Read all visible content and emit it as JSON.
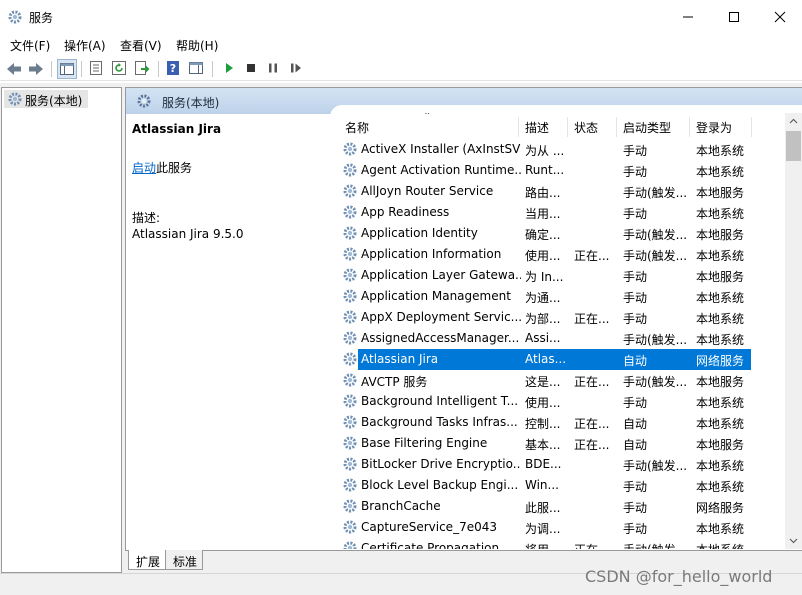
{
  "window": {
    "title": "服务"
  },
  "menu": [
    "文件(F)",
    "操作(A)",
    "查看(V)",
    "帮助(H)"
  ],
  "tree": {
    "selected_label": "服务(本地)"
  },
  "panel": {
    "header_label": "服务(本地)"
  },
  "description": {
    "service_title": "Atlassian Jira",
    "start_link": "启动",
    "start_suffix": "此服务",
    "desc_label": "描述:",
    "desc_text": "Atlassian Jira 9.5.0"
  },
  "columns": {
    "name": "名称",
    "description": "描述",
    "status": "状态",
    "startup_type": "启动类型",
    "logon_as": "登录为"
  },
  "services": [
    {
      "name": "ActiveX Installer (AxInstSV)",
      "description": "为从 ...",
      "status": "",
      "startup": "手动",
      "logon": "本地系统"
    },
    {
      "name": "Agent Activation Runtime...",
      "description": "Runt...",
      "status": "",
      "startup": "手动",
      "logon": "本地系统"
    },
    {
      "name": "AllJoyn Router Service",
      "description": "路由...",
      "status": "",
      "startup": "手动(触发...",
      "logon": "本地服务"
    },
    {
      "name": "App Readiness",
      "description": "当用...",
      "status": "",
      "startup": "手动",
      "logon": "本地系统"
    },
    {
      "name": "Application Identity",
      "description": "确定...",
      "status": "",
      "startup": "手动(触发...",
      "logon": "本地服务"
    },
    {
      "name": "Application Information",
      "description": "使用...",
      "status": "正在...",
      "startup": "手动(触发...",
      "logon": "本地系统"
    },
    {
      "name": "Application Layer Gatewa...",
      "description": "为 In...",
      "status": "",
      "startup": "手动",
      "logon": "本地服务"
    },
    {
      "name": "Application Management",
      "description": "为通...",
      "status": "",
      "startup": "手动",
      "logon": "本地系统"
    },
    {
      "name": "AppX Deployment Servic...",
      "description": "为部...",
      "status": "正在...",
      "startup": "手动",
      "logon": "本地系统"
    },
    {
      "name": "AssignedAccessManager...",
      "description": "Assi...",
      "status": "",
      "startup": "手动(触发...",
      "logon": "本地系统"
    },
    {
      "name": "Atlassian Jira",
      "description": "Atlas...",
      "status": "",
      "startup": "自动",
      "logon": "网络服务",
      "selected": true
    },
    {
      "name": "AVCTP 服务",
      "description": "这是...",
      "status": "正在...",
      "startup": "手动(触发...",
      "logon": "本地服务"
    },
    {
      "name": "Background Intelligent T...",
      "description": "使用...",
      "status": "",
      "startup": "手动",
      "logon": "本地系统"
    },
    {
      "name": "Background Tasks Infras...",
      "description": "控制...",
      "status": "正在...",
      "startup": "自动",
      "logon": "本地系统"
    },
    {
      "name": "Base Filtering Engine",
      "description": "基本...",
      "status": "正在...",
      "startup": "自动",
      "logon": "本地服务"
    },
    {
      "name": "BitLocker Drive Encryptio...",
      "description": "BDE...",
      "status": "",
      "startup": "手动(触发...",
      "logon": "本地系统"
    },
    {
      "name": "Block Level Backup Engi...",
      "description": "Win...",
      "status": "",
      "startup": "手动",
      "logon": "本地系统"
    },
    {
      "name": "BranchCache",
      "description": "此服...",
      "status": "",
      "startup": "手动",
      "logon": "网络服务"
    },
    {
      "name": "CaptureService_7e043",
      "description": "为调...",
      "status": "",
      "startup": "手动",
      "logon": "本地系统"
    },
    {
      "name": "Certificate Propagation",
      "description": "将用...",
      "status": "正在...",
      "startup": "手动(触发...",
      "logon": "本地系统"
    }
  ],
  "tabs": [
    "扩展",
    "标准"
  ],
  "watermark": "CSDN @for_hello_world"
}
